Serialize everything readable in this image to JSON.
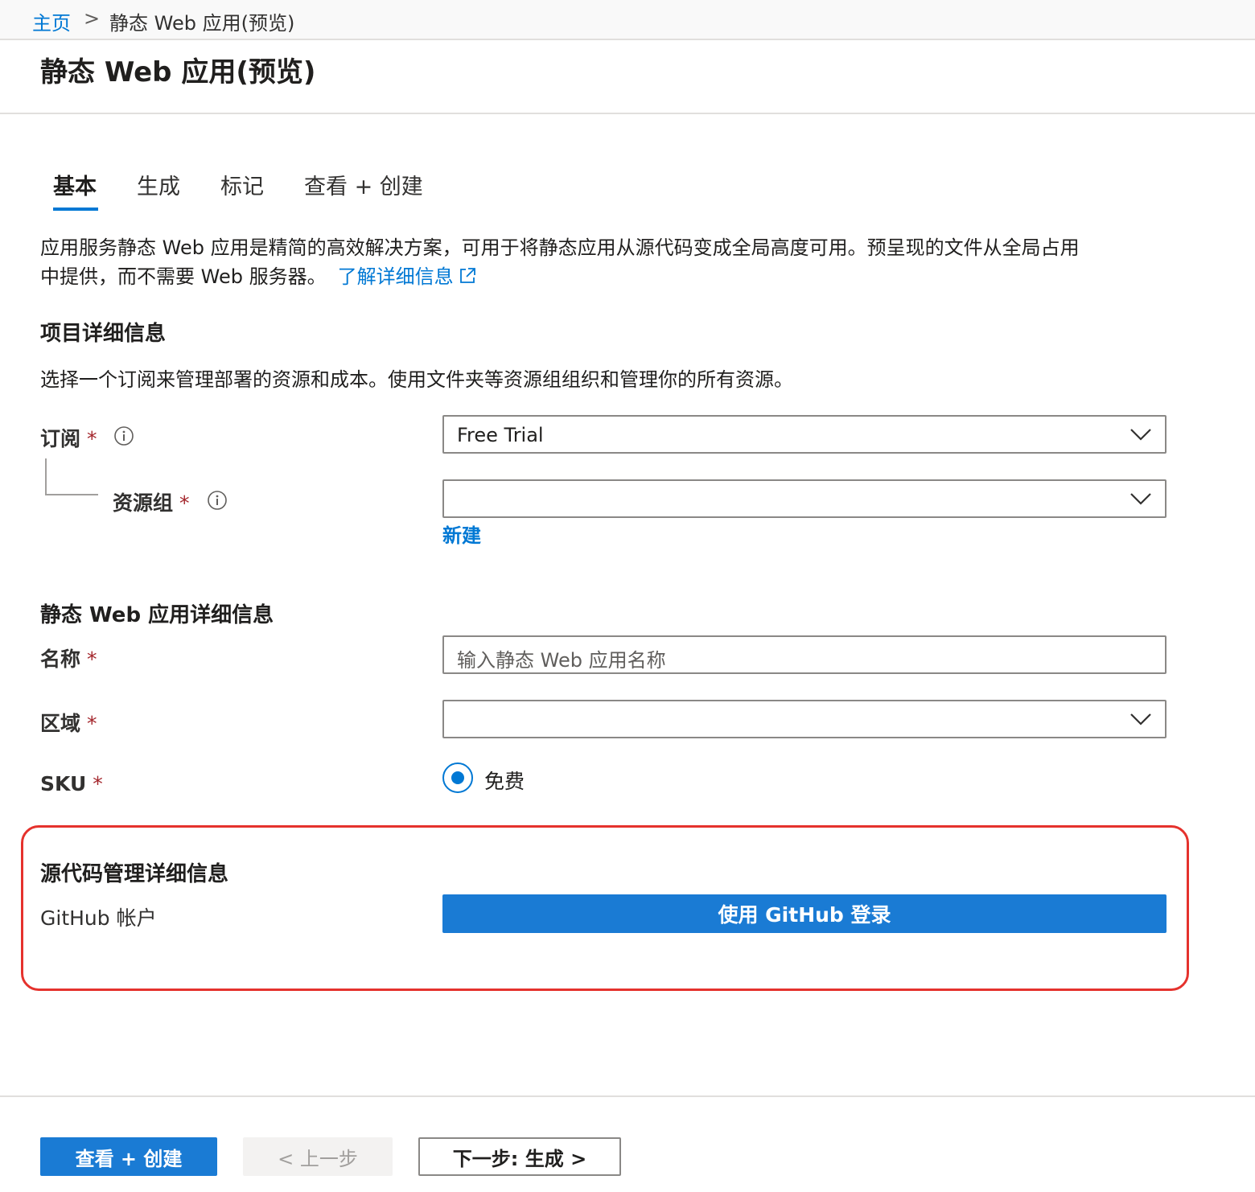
{
  "breadcrumb": {
    "home": "主页",
    "separator": ">",
    "current": "静态 Web 应用(预览)"
  },
  "page_title": "静态 Web 应用(预览)",
  "tabs": [
    {
      "label": "基本",
      "active": true
    },
    {
      "label": "生成",
      "active": false
    },
    {
      "label": "标记",
      "active": false
    },
    {
      "label": "查看 + 创建",
      "active": false
    }
  ],
  "intro": {
    "line1": "应用服务静态 Web 应用是精简的高效解决方案，可用于将静态应用从源代码变成全局高度可用。预呈现的文件从全局占用",
    "line2": "中提供，而不需要 Web 服务器。",
    "learn_more": "了解详细信息"
  },
  "project": {
    "title": "项目详细信息",
    "description": "选择一个订阅来管理部署的资源和成本。使用文件夹等资源组组织和管理你的所有资源。",
    "subscription": {
      "label": "订阅",
      "required": "*",
      "value": "Free Trial"
    },
    "resource_group": {
      "label": "资源组",
      "required": "*",
      "value": "",
      "new_link": "新建"
    }
  },
  "app_details": {
    "title": "静态 Web 应用详细信息",
    "name": {
      "label": "名称",
      "required": "*",
      "placeholder": "输入静态 Web 应用名称"
    },
    "region": {
      "label": "区域",
      "required": "*",
      "value": ""
    },
    "sku": {
      "label": "SKU",
      "required": "*",
      "option": "免费",
      "selected": true
    }
  },
  "source_control": {
    "title": "源代码管理详细信息",
    "account_label": "GitHub 帐户",
    "login_button": "使用 GitHub 登录"
  },
  "footer": {
    "review_create": "查看 + 创建",
    "previous": "< 上一步",
    "next": "下一步: 生成 >"
  },
  "colors": {
    "accent": "#0078d4",
    "button_blue": "#1a7bd4",
    "required": "#a4262c",
    "highlight": "#e5322d"
  },
  "icons": [
    "chevron-right-icon",
    "external-link-icon",
    "info-icon",
    "chevron-down-icon"
  ]
}
